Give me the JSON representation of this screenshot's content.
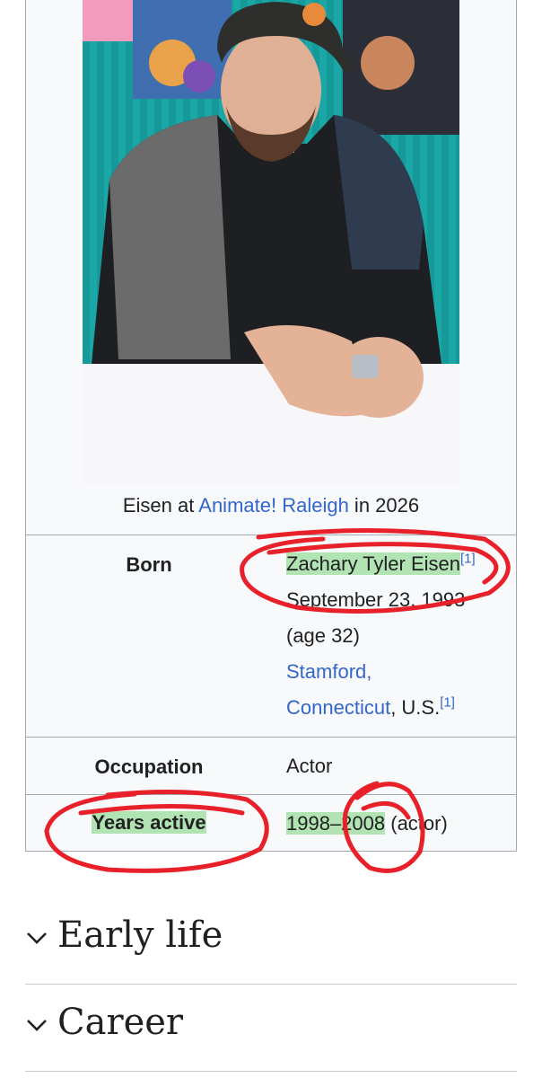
{
  "infobox": {
    "caption": {
      "prefix": "Eisen at ",
      "link": "Animate! Raleigh",
      "suffix": " in 2026"
    },
    "born": {
      "label": "Born",
      "name": "Zachary Tyler Eisen",
      "name_ref": "[1]",
      "date": "September 23, 1993",
      "age": "(age 32)",
      "place_link_1": "Stamford,",
      "place_link_2": "Connecticut",
      "place_suffix": ", U.S.",
      "place_ref": "[1]"
    },
    "occupation": {
      "label": "Occupation",
      "value": "Actor"
    },
    "years_active": {
      "label": "Years active",
      "value": "1998–2008",
      "suffix": " (actor)"
    }
  },
  "sections": [
    {
      "title": "Early life"
    },
    {
      "title": "Career"
    }
  ],
  "colors": {
    "link": "#3366cc",
    "highlight": "#7fd27f",
    "annotation": "#e8202a",
    "border": "#a2a9b1"
  },
  "icons": {
    "section_toggle": "chevron-down-icon"
  }
}
